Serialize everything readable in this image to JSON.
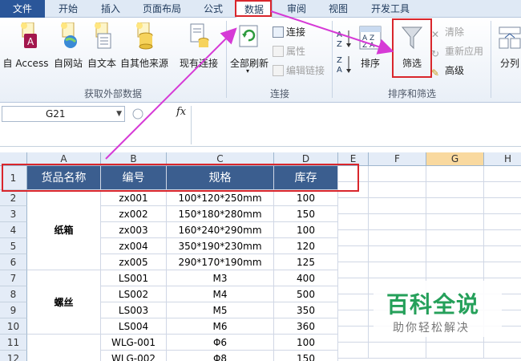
{
  "tabs": [
    "文件",
    "开始",
    "插入",
    "页面布局",
    "公式",
    "数据",
    "审阅",
    "视图",
    "开发工具"
  ],
  "ribbon": {
    "ext_data": {
      "access": "自 Access",
      "web": "自网站",
      "text": "自文本",
      "other": "自其他来源",
      "existing": "现有连接",
      "group": "获取外部数据"
    },
    "connections": {
      "refresh": "全部刷新",
      "connect": "连接",
      "props": "属性",
      "edit_links": "编辑链接",
      "group": "连接"
    },
    "sort_filter": {
      "sort": "排序",
      "filter": "筛选",
      "clear": "清除",
      "reapply": "重新应用",
      "advanced": "高级",
      "group": "排序和筛选"
    },
    "split": "分列"
  },
  "formula_bar": {
    "name_box": "G21",
    "fx": "fx",
    "value": ""
  },
  "sheet": {
    "columns": [
      "A",
      "B",
      "C",
      "D",
      "E",
      "F",
      "G",
      "H"
    ],
    "rows": [
      "1",
      "2",
      "3",
      "4",
      "5",
      "6",
      "7",
      "8",
      "9",
      "10",
      "11",
      "12"
    ],
    "header": [
      "货品名称",
      "编号",
      "规格",
      "库存"
    ],
    "group_labels": [
      "纸箱",
      "螺丝"
    ],
    "data": [
      [
        "zx001",
        "100*120*250mm",
        "100"
      ],
      [
        "zx002",
        "150*180*280mm",
        "150"
      ],
      [
        "zx003",
        "160*240*290mm",
        "100"
      ],
      [
        "zx004",
        "350*190*230mm",
        "120"
      ],
      [
        "zx005",
        "290*170*190mm",
        "125"
      ],
      [
        "LS001",
        "M3",
        "400"
      ],
      [
        "LS002",
        "M4",
        "500"
      ],
      [
        "LS003",
        "M5",
        "350"
      ],
      [
        "LS004",
        "M6",
        "360"
      ],
      [
        "WLG-001",
        "Φ6",
        "100"
      ],
      [
        "WLG-002",
        "Φ8",
        "150"
      ]
    ]
  },
  "watermark": {
    "title": "百科全说",
    "subtitle": "助你轻松解决"
  },
  "colors": {
    "header_fill": "#3b5e8f",
    "annotation": "#d9262c",
    "arrow": "#d63ad6",
    "watermark": "#25a05a"
  }
}
